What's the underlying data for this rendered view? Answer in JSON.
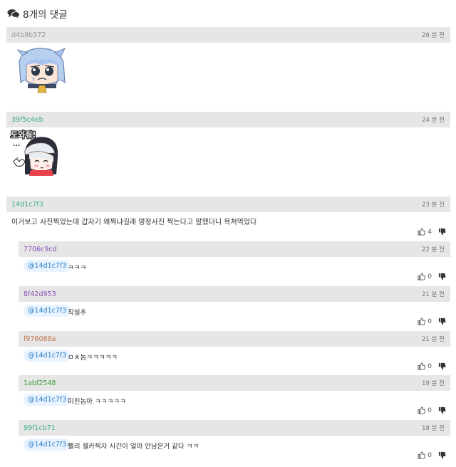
{
  "header": {
    "title": "8개의 댓글"
  },
  "comments": [
    {
      "author": "d4b9b372",
      "time": "26 분 전",
      "color": "#999999",
      "likes": "0",
      "type": "sticker"
    },
    {
      "author": "39f5c4eb",
      "time": "24 분 전",
      "color": "#3fb08b",
      "likes": "0",
      "type": "sticker"
    },
    {
      "author": "14d1c7f3",
      "time": "23 분 전",
      "color": "#3fb08b",
      "likes": "4",
      "type": "text",
      "text": "이거보고 사진찍었는데 갑자기 왜찍냐길래 영정사진 찍는다고 말했더니 욕쳐먹었다"
    },
    {
      "author": "7706c9cd",
      "time": "22 분 전",
      "color": "#8a4fb5",
      "likes": "0",
      "type": "reply",
      "mention": "@14d1c7f3",
      "text": "ㅋㅋㅋ"
    },
    {
      "author": "8f42d953",
      "time": "21 분 전",
      "color": "#8a4fb5",
      "likes": "0",
      "type": "reply",
      "mention": "@14d1c7f3",
      "text": "직설추"
    },
    {
      "author": "f976088a",
      "time": "21 분 전",
      "color": "#c07a4a",
      "likes": "0",
      "type": "reply",
      "mention": "@14d1c7f3",
      "text": "ㅁㅊ놈ㅋㅋㅋㅋㅋ"
    },
    {
      "author": "1abf2548",
      "time": "19 분 전",
      "color": "#3f9e3f",
      "likes": "0",
      "type": "reply",
      "mention": "@14d1c7f3",
      "text": "미친놈아 ㅋㅋㅋㅋㅋ"
    },
    {
      "author": "99f1cb71",
      "time": "18 분 전",
      "color": "#3fb08b",
      "likes": "0",
      "type": "reply",
      "mention": "@14d1c7f3",
      "text": "빨리 셀카찍자 시간이 얼마 안남은거 같다 ㅋㅋ"
    }
  ],
  "stickers": [
    {
      "name": "crying-chibi-sticker"
    },
    {
      "name": "hooded-chibi-sticker",
      "caption": "도와줘!",
      "dots": "..."
    }
  ]
}
